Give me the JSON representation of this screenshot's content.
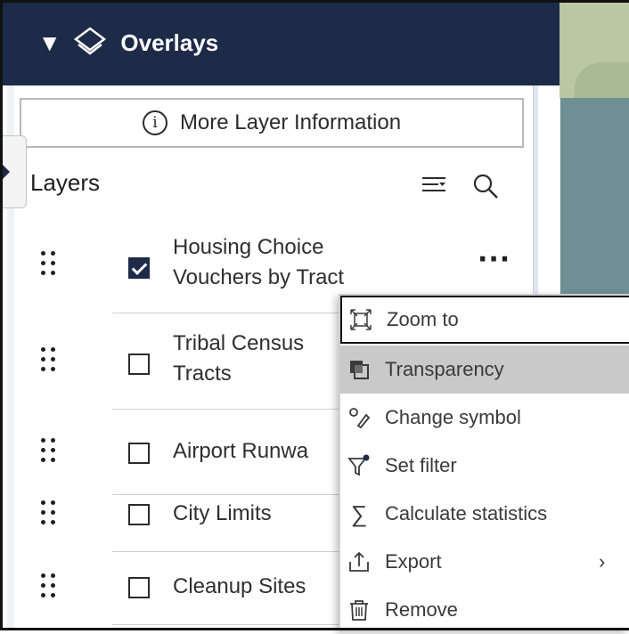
{
  "header": {
    "title": "Overlays"
  },
  "more_info": {
    "label": "More Layer Information"
  },
  "layers_panel": {
    "title": "Layers"
  },
  "layers": [
    {
      "name": "Housing Choice Vouchers by Tract",
      "lines": [
        "Housing Choice",
        "Vouchers by Tract"
      ],
      "checked": true
    },
    {
      "name": "Tribal Census Tracts",
      "lines": [
        "Tribal Census",
        "Tracts"
      ],
      "checked": false
    },
    {
      "name": "Airport Runways",
      "lines": [
        "Airport Runwa"
      ],
      "checked": false
    },
    {
      "name": "City Limits",
      "lines": [
        "City Limits"
      ],
      "checked": false
    },
    {
      "name": "Cleanup Sites",
      "lines": [
        "Cleanup Sites"
      ],
      "checked": false
    }
  ],
  "menu": {
    "items": [
      {
        "label": "Zoom to",
        "icon": "zoom-to-icon",
        "state": "focused"
      },
      {
        "label": "Transparency",
        "icon": "transparency-icon",
        "state": "hovered"
      },
      {
        "label": "Change symbol",
        "icon": "change-symbol-icon"
      },
      {
        "label": "Set filter",
        "icon": "filter-icon"
      },
      {
        "label": "Calculate statistics",
        "icon": "sigma-icon"
      },
      {
        "label": "Export",
        "icon": "export-icon",
        "submenu": true
      },
      {
        "label": "Remove",
        "icon": "trash-icon"
      }
    ]
  },
  "colors": {
    "header_bg": "#1d2a48",
    "checkbox_checked": "#1d2a48",
    "hover_bg": "#c9c9c9",
    "map_water": "#6f8f94"
  }
}
